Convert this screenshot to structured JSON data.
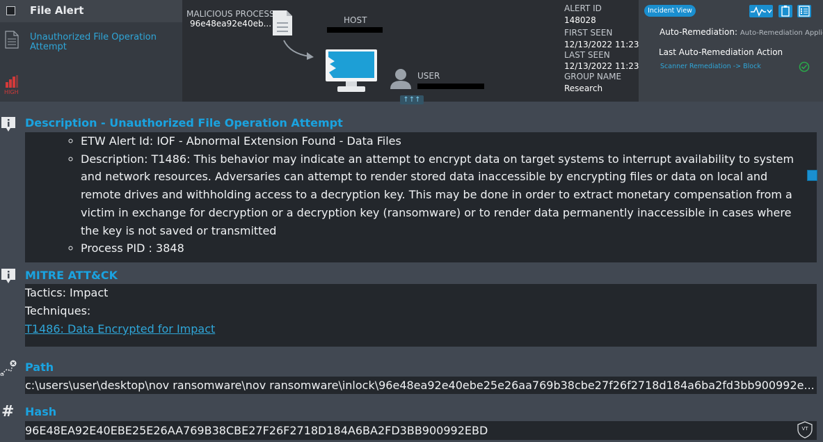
{
  "header": {
    "title": "File Alert",
    "subtitle": "Unauthorized File Operation Attempt",
    "severity": "HIGH",
    "malicious_process_label": "MALICIOUS PROCESS",
    "malicious_process_value": "96e48ea92e40eb...",
    "host_label": "HOST",
    "user_label": "USER",
    "expand_label": "↑↑↑"
  },
  "meta": {
    "alert_id_label": "ALERT ID",
    "alert_id": "148028",
    "first_seen_label": "FIRST SEEN",
    "first_seen": "12/13/2022 11:23",
    "last_seen_label": "LAST SEEN",
    "last_seen": "12/13/2022 11:23",
    "group_name_label": "GROUP NAME",
    "group_name": "Research"
  },
  "right_panel": {
    "incident_view_label": "Incident View",
    "auto_remediation_label": "Auto-Remediation:",
    "auto_remediation_value": "Auto-Remediation Applied",
    "last_action_label": "Last Auto-Remediation Action",
    "last_action_value": "Scanner Remediation -> Block"
  },
  "description": {
    "title": "Description - Unauthorized File Operation Attempt",
    "items": [
      "ETW Alert Id: IOF - Abnormal Extension Found - Data Files",
      "Description: T1486: This behavior may indicate an attempt to encrypt data on target systems to interrupt availability to system and network resources. Adversaries can attempt to render stored data inaccessible by encrypting files or data on local and remote drives and withholding access to a decryption key. This may be done in order to extract monetary compensation from a victim in exchange for decryption or a decryption key (ransomware) or to render data permanently inaccessible in cases where the key is not saved or transmitted",
      "Process PID : 3848"
    ]
  },
  "mitre": {
    "title": "MITRE ATT&CK",
    "tactics": "Tactics: Impact",
    "techniques_label": "Techniques:",
    "technique_link": "T1486: Data Encrypted for Impact"
  },
  "path": {
    "title": "Path",
    "value": "c:\\users\\user\\desktop\\nov ransomware\\nov ransomware\\inlock\\96e48ea92e40ebe25e26aa769b38cbe27f26f2718d184a6ba2fd3bb900992e..."
  },
  "hash": {
    "title": "Hash",
    "value": "96E48EA92E40EBE25E26AA769B38CBE27F26F2718D184A6BA2FD3BB900992EBD",
    "vt_label": "VT"
  },
  "colors": {
    "accent": "#1aa3e0",
    "severity": "#d33a3a",
    "ok": "#2aa84a"
  }
}
